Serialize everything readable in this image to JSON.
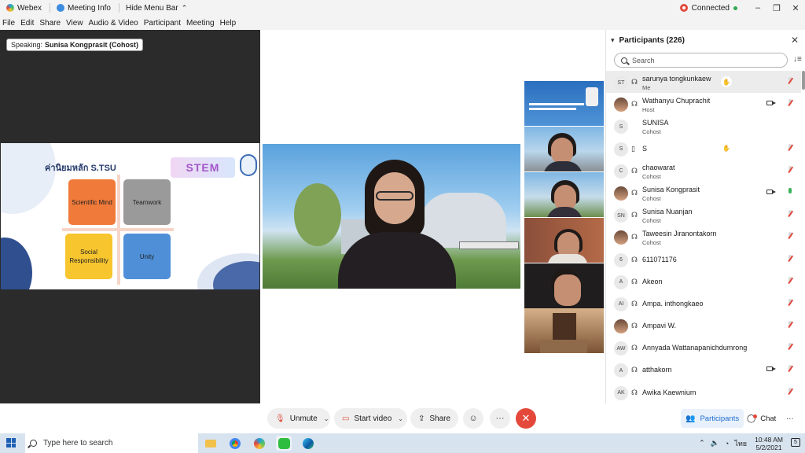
{
  "titlebar": {
    "app": "Webex",
    "meeting_info": "Meeting Info",
    "hide_menu": "Hide Menu Bar",
    "hide_menu_chevron": "⌃",
    "status": "Connected",
    "win_min": "–",
    "win_max": "❐",
    "win_close": "✕"
  },
  "menu": [
    "File",
    "Edit",
    "Share",
    "View",
    "Audio & Video",
    "Participant",
    "Meeting",
    "Help"
  ],
  "speaking": {
    "prefix": "Speaking:",
    "name": "Sunisa Kongprasit (Cohost)"
  },
  "slide": {
    "title": "ค่านิยมหลัก S.TSU",
    "logo_text": "STEM",
    "quadrants": [
      "Scientific Mind",
      "Teamwork",
      "Social Responsibility",
      "Unity"
    ]
  },
  "participants": {
    "title": "Participants (226)",
    "close": "✕",
    "sort": "↓≡",
    "search_placeholder": "Search",
    "list": [
      {
        "initials": "ST",
        "name": "sarunya tongkunkaew",
        "role": "Me",
        "hand": true,
        "video": false,
        "mic": "muted",
        "me": true,
        "device": "headset"
      },
      {
        "initials": "",
        "photo": true,
        "name": "Wathanyu Chuprachit",
        "role": "Host",
        "hand": false,
        "video": true,
        "mic": "muted",
        "device": "headset"
      },
      {
        "initials": "S",
        "name": "SUNISA",
        "role": "Cohost",
        "hand": false,
        "video": false,
        "mic": "none",
        "device": ""
      },
      {
        "initials": "S",
        "name": "S",
        "role": "",
        "hand": true,
        "video": false,
        "mic": "muted",
        "device": "phone"
      },
      {
        "initials": "C",
        "name": "chaowarat",
        "role": "Cohost",
        "hand": false,
        "video": false,
        "mic": "muted",
        "device": "headset"
      },
      {
        "initials": "",
        "photo": true,
        "name": "Sunisa Kongprasit",
        "role": "Cohost",
        "hand": false,
        "video": true,
        "mic": "on",
        "device": "headset"
      },
      {
        "initials": "SN",
        "name": "Sunisa Nuanjan",
        "role": "Cohost",
        "hand": false,
        "video": false,
        "mic": "muted",
        "device": "headset"
      },
      {
        "initials": "",
        "photo": true,
        "name": "Taweesin Jiranontakorn",
        "role": "Cohost",
        "hand": false,
        "video": false,
        "mic": "muted",
        "device": "headset"
      },
      {
        "initials": "6",
        "name": "611071176",
        "role": "",
        "hand": false,
        "video": false,
        "mic": "muted",
        "device": "headset"
      },
      {
        "initials": "A",
        "name": "Akeon",
        "role": "",
        "hand": false,
        "video": false,
        "mic": "muted",
        "device": "headset"
      },
      {
        "initials": "AI",
        "name": "Ampa. inthongkaeo",
        "role": "",
        "hand": false,
        "video": false,
        "mic": "muted",
        "device": "headset"
      },
      {
        "initials": "",
        "photo": true,
        "name": "Ampavi W.",
        "role": "",
        "hand": false,
        "video": false,
        "mic": "muted",
        "device": "headset"
      },
      {
        "initials": "AW",
        "name": "Annyada Wattanapanichdumrong",
        "role": "",
        "hand": false,
        "video": false,
        "mic": "muted",
        "device": "headset"
      },
      {
        "initials": "A",
        "name": "atthakorn",
        "role": "",
        "hand": false,
        "video": true,
        "mic": "muted",
        "device": "headset"
      },
      {
        "initials": "AK",
        "name": "Awika Kaewnium",
        "role": "",
        "hand": false,
        "video": false,
        "mic": "muted",
        "device": "headset"
      }
    ]
  },
  "controls": {
    "unmute": "Unmute",
    "start_video": "Start video",
    "share": "Share",
    "reactions": "☺",
    "more": "···",
    "end": "✕",
    "participants": "Participants",
    "chat": "Chat",
    "panel_more": "···"
  },
  "taskbar": {
    "search": "Type here to search",
    "lang": "ไทย",
    "time": "10:48 AM",
    "date": "5/2/2021",
    "notif_badge": "5"
  },
  "colors": {
    "accent": "#1f6ccf",
    "end": "#e4483b",
    "muted": "#e2483b",
    "mic_on": "#3bb35a"
  }
}
